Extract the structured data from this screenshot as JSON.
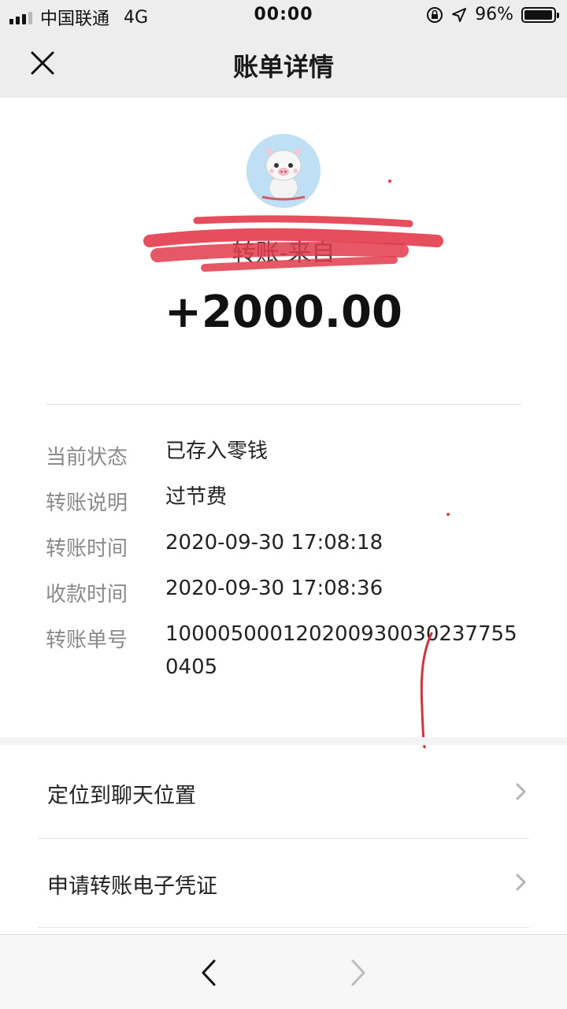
{
  "status_bar": {
    "carrier": "中国联通",
    "network": "4G",
    "time": "00:00",
    "battery": "96%"
  },
  "header": {
    "title": "账单详情",
    "close_icon": "close-icon"
  },
  "transfer": {
    "from_text": "转账-来自",
    "amount": "+2000.00"
  },
  "details": [
    {
      "label": "当前状态",
      "value": "已存入零钱"
    },
    {
      "label": "转账说明",
      "value": "过节费"
    },
    {
      "label": "转账时间",
      "value": "2020-09-30 17:08:18"
    },
    {
      "label": "收款时间",
      "value": "2020-09-30 17:08:36"
    },
    {
      "label": "转账单号",
      "value": "100005000120200930030237755 0405"
    }
  ],
  "actions": [
    {
      "label": "定位到聊天位置",
      "icon": "chevron-right-icon"
    },
    {
      "label": "申请转账电子凭证",
      "icon": "chevron-right-icon"
    }
  ],
  "bottom_nav": {
    "back_icon": "chevron-left-icon",
    "forward_icon": "chevron-right-icon"
  },
  "colors": {
    "header_bg": "#ededed",
    "label_gray": "#8a8a8a",
    "redaction": "#e23b4a"
  }
}
